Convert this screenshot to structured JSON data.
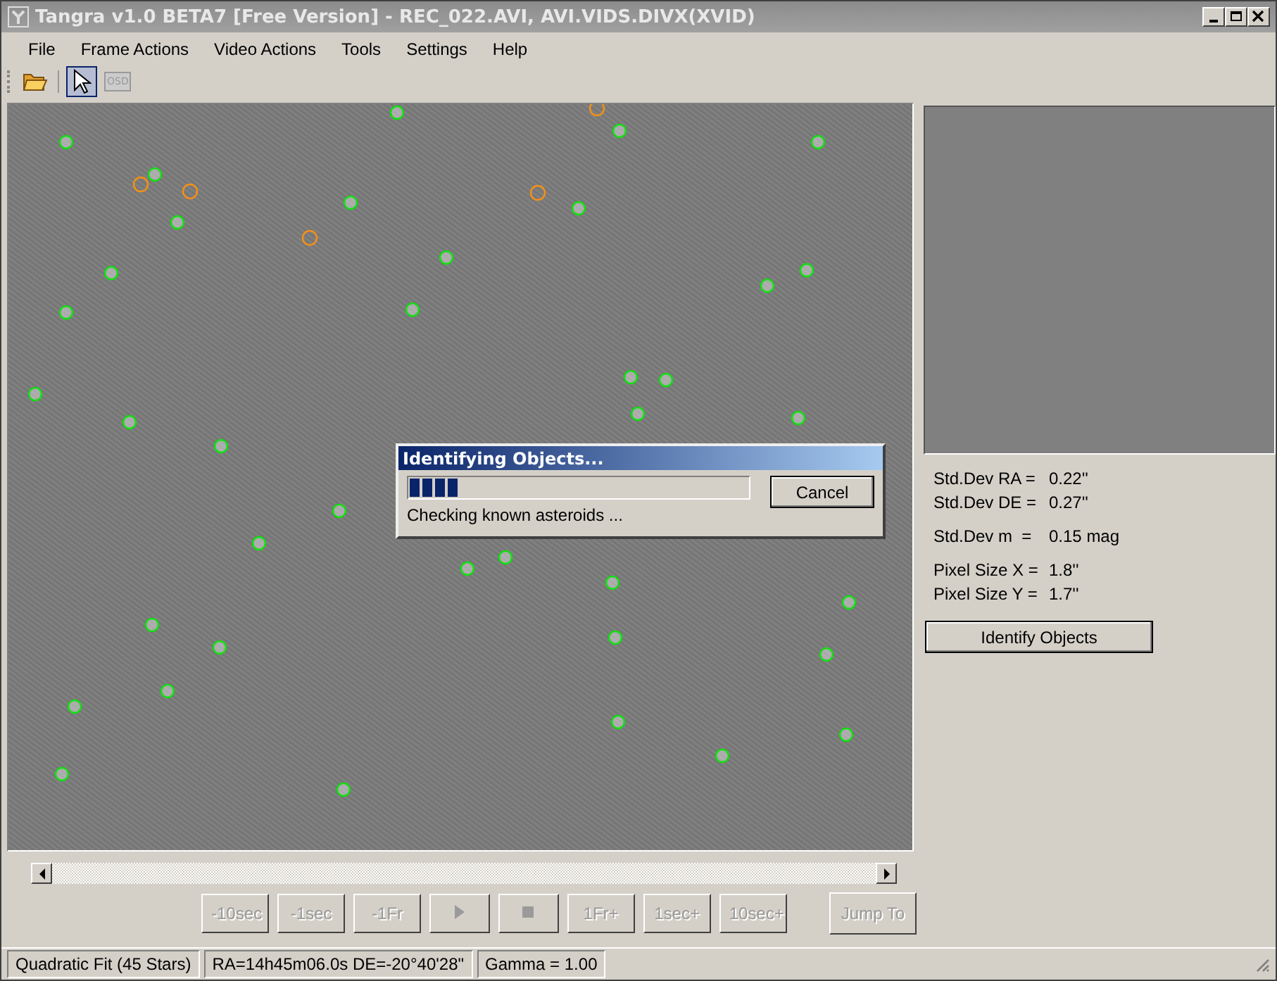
{
  "window": {
    "title": "Tangra v1.0 BETA7 [Free Version] - REC_022.AVI, AVI.VIDS.DIVX(XVID)"
  },
  "menu": [
    "File",
    "Frame Actions",
    "Video Actions",
    "Tools",
    "Settings",
    "Help"
  ],
  "toolbar": [
    {
      "kind": "open",
      "selected": false
    },
    {
      "kind": "pointer",
      "selected": true
    },
    {
      "kind": "osd",
      "label": "OSD",
      "selected": false,
      "disabled": true
    }
  ],
  "dialog": {
    "title": "Identifying Objects...",
    "level": 0.15,
    "status": "Checking known asteroids ...",
    "button": "Cancel"
  },
  "stats": [
    [
      {
        "label": "Std.Dev RA =",
        "value": "0.22''"
      },
      {
        "label": "Std.Dev DE =",
        "value": "0.27''"
      }
    ],
    [
      {
        "label": "Std.Dev m  =",
        "value": "0.15 mag"
      }
    ],
    [
      {
        "label": "Pixel Size X =",
        "value": "1.8''"
      },
      {
        "label": "Pixel Size Y =",
        "value": "1.7''"
      }
    ]
  ],
  "identify_button": "Identify Objects",
  "transport": [
    {
      "kind": "text",
      "label": "-10sec",
      "disabled": true
    },
    {
      "kind": "text",
      "label": "-1sec",
      "disabled": true
    },
    {
      "kind": "text",
      "label": "-1Fr",
      "disabled": true
    },
    {
      "kind": "play",
      "disabled": true
    },
    {
      "kind": "stop",
      "disabled": true
    },
    {
      "kind": "text",
      "label": "1Fr+",
      "disabled": true
    },
    {
      "kind": "text",
      "label": "1sec+",
      "disabled": true
    },
    {
      "kind": "text",
      "label": "10sec+",
      "disabled": true
    }
  ],
  "jump_button": {
    "label": "Jump To",
    "disabled": true
  },
  "status_bar": [
    "Quadratic Fit (45 Stars)",
    "RA=14h45m06.0s DE=-20°40'28\"",
    "Gamma = 1.00"
  ]
}
